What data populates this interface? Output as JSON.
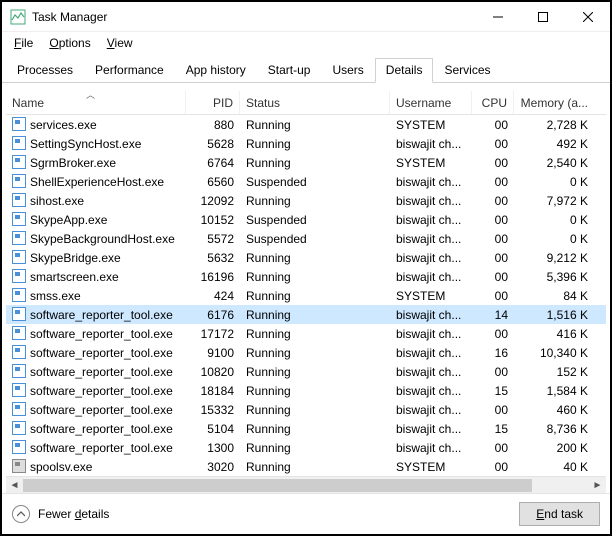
{
  "window": {
    "title": "Task Manager"
  },
  "menu": {
    "file": "File",
    "options": "Options",
    "view": "View"
  },
  "tabs": {
    "processes": "Processes",
    "performance": "Performance",
    "app_history": "App history",
    "startup": "Start-up",
    "users": "Users",
    "details": "Details",
    "services": "Services"
  },
  "columns": {
    "name": "Name",
    "pid": "PID",
    "status": "Status",
    "username": "Username",
    "cpu": "CPU",
    "memory": "Memory (a..."
  },
  "rows": [
    {
      "name": "services.exe",
      "pid": "880",
      "status": "Running",
      "user": "SYSTEM",
      "cpu": "00",
      "mem": "2,728 K",
      "icon": "exe"
    },
    {
      "name": "SettingSyncHost.exe",
      "pid": "5628",
      "status": "Running",
      "user": "biswajit ch...",
      "cpu": "00",
      "mem": "492 K",
      "icon": "exe"
    },
    {
      "name": "SgrmBroker.exe",
      "pid": "6764",
      "status": "Running",
      "user": "SYSTEM",
      "cpu": "00",
      "mem": "2,540 K",
      "icon": "exe"
    },
    {
      "name": "ShellExperienceHost.exe",
      "pid": "6560",
      "status": "Suspended",
      "user": "biswajit ch...",
      "cpu": "00",
      "mem": "0 K",
      "icon": "exe"
    },
    {
      "name": "sihost.exe",
      "pid": "12092",
      "status": "Running",
      "user": "biswajit ch...",
      "cpu": "00",
      "mem": "7,972 K",
      "icon": "exe"
    },
    {
      "name": "SkypeApp.exe",
      "pid": "10152",
      "status": "Suspended",
      "user": "biswajit ch...",
      "cpu": "00",
      "mem": "0 K",
      "icon": "exe"
    },
    {
      "name": "SkypeBackgroundHost.exe",
      "pid": "5572",
      "status": "Suspended",
      "user": "biswajit ch...",
      "cpu": "00",
      "mem": "0 K",
      "icon": "exe"
    },
    {
      "name": "SkypeBridge.exe",
      "pid": "5632",
      "status": "Running",
      "user": "biswajit ch...",
      "cpu": "00",
      "mem": "9,212 K",
      "icon": "exe"
    },
    {
      "name": "smartscreen.exe",
      "pid": "16196",
      "status": "Running",
      "user": "biswajit ch...",
      "cpu": "00",
      "mem": "5,396 K",
      "icon": "exe"
    },
    {
      "name": "smss.exe",
      "pid": "424",
      "status": "Running",
      "user": "SYSTEM",
      "cpu": "00",
      "mem": "84 K",
      "icon": "exe"
    },
    {
      "name": "software_reporter_tool.exe",
      "pid": "6176",
      "status": "Running",
      "user": "biswajit ch...",
      "cpu": "14",
      "mem": "1,516 K",
      "icon": "exe",
      "selected": true
    },
    {
      "name": "software_reporter_tool.exe",
      "pid": "17172",
      "status": "Running",
      "user": "biswajit ch...",
      "cpu": "00",
      "mem": "416 K",
      "icon": "exe"
    },
    {
      "name": "software_reporter_tool.exe",
      "pid": "9100",
      "status": "Running",
      "user": "biswajit ch...",
      "cpu": "16",
      "mem": "10,340 K",
      "icon": "exe"
    },
    {
      "name": "software_reporter_tool.exe",
      "pid": "10820",
      "status": "Running",
      "user": "biswajit ch...",
      "cpu": "00",
      "mem": "152 K",
      "icon": "exe"
    },
    {
      "name": "software_reporter_tool.exe",
      "pid": "18184",
      "status": "Running",
      "user": "biswajit ch...",
      "cpu": "15",
      "mem": "1,584 K",
      "icon": "exe"
    },
    {
      "name": "software_reporter_tool.exe",
      "pid": "15332",
      "status": "Running",
      "user": "biswajit ch...",
      "cpu": "00",
      "mem": "460 K",
      "icon": "exe"
    },
    {
      "name": "software_reporter_tool.exe",
      "pid": "5104",
      "status": "Running",
      "user": "biswajit ch...",
      "cpu": "15",
      "mem": "8,736 K",
      "icon": "exe"
    },
    {
      "name": "software_reporter_tool.exe",
      "pid": "1300",
      "status": "Running",
      "user": "biswajit ch...",
      "cpu": "00",
      "mem": "200 K",
      "icon": "exe"
    },
    {
      "name": "spoolsv.exe",
      "pid": "3020",
      "status": "Running",
      "user": "SYSTEM",
      "cpu": "00",
      "mem": "40 K",
      "icon": "printer"
    }
  ],
  "footer": {
    "fewer_details": "Fewer details",
    "end_task": "End task"
  }
}
